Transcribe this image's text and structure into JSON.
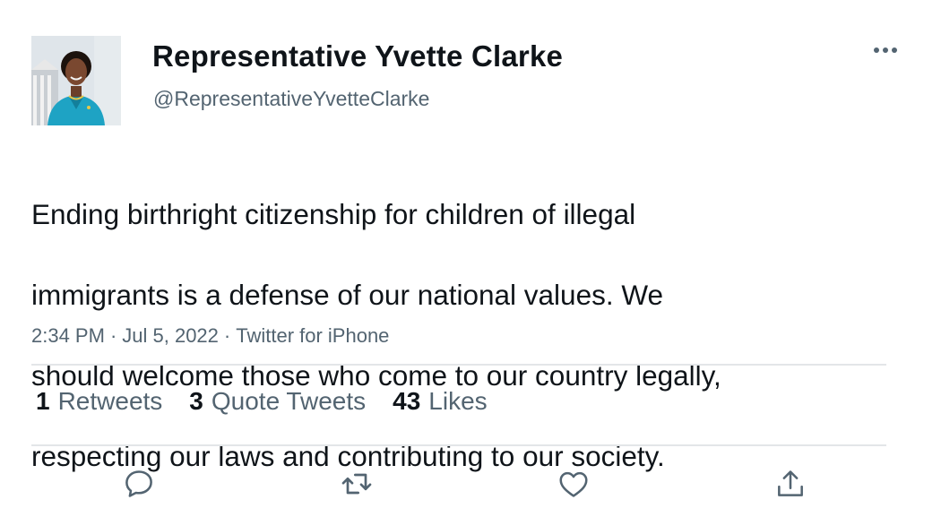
{
  "tweet": {
    "display_name": "Representative Yvette Clarke",
    "handle": "@RepresentativeYvetteClarke",
    "text_lines": [
      "Ending birthright citizenship for children of illegal",
      "immigrants is a defense of our national values. We",
      "should welcome those who come to our country legally,",
      "respecting our laws and contributing to our society."
    ],
    "time": "2:34 PM",
    "separator": "·",
    "date": "Jul 5, 2022",
    "source": "Twitter for iPhone"
  },
  "stats": {
    "retweets": {
      "count": "1",
      "label": "Retweets"
    },
    "quotes": {
      "count": "3",
      "label": "Quote Tweets"
    },
    "likes": {
      "count": "43",
      "label": "Likes"
    }
  },
  "icons": {
    "more": "more-horizontal-icon",
    "reply": "reply-icon",
    "retweet": "retweet-icon",
    "like": "heart-icon",
    "share": "share-icon"
  },
  "colors": {
    "text_primary": "#0f1419",
    "text_secondary": "#536471",
    "icon": "#536471",
    "divider": "#e3e6e8"
  }
}
